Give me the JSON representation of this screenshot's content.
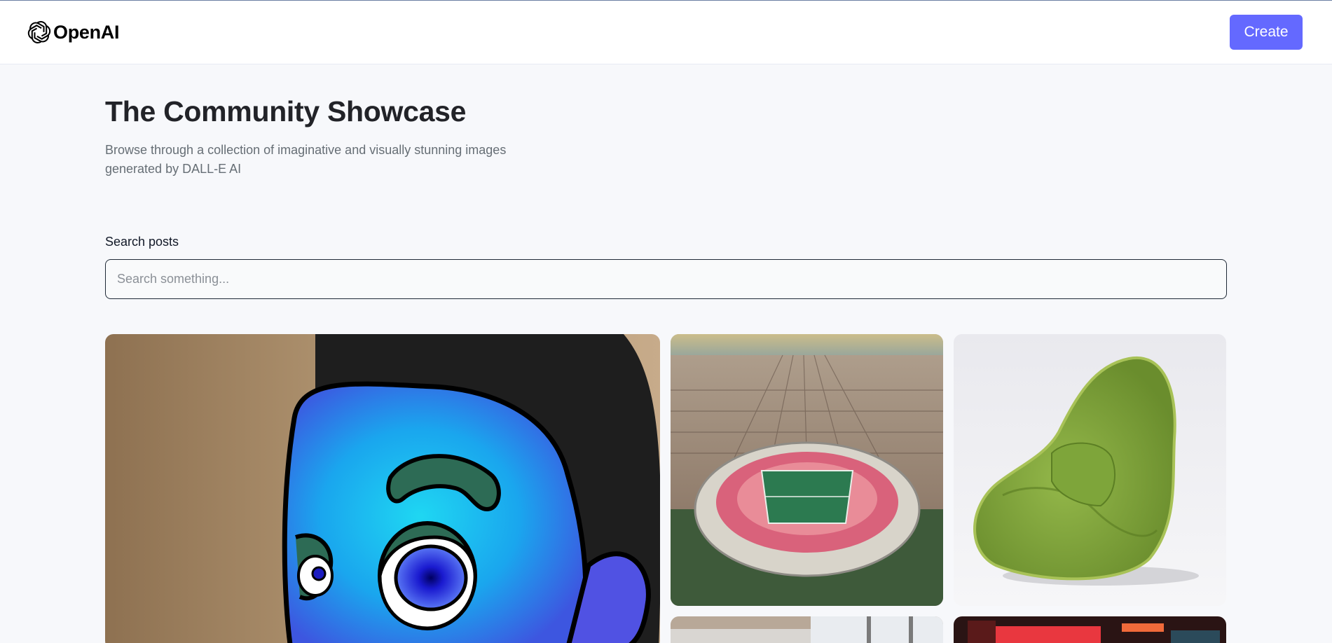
{
  "header": {
    "brand": "OpenAI",
    "logo_icon": "openai-logo-icon",
    "create_label": "Create",
    "accent_color": "#6469ff"
  },
  "page": {
    "title": "The Community Showcase",
    "subtitle": "Browse through a collection of imaginative and visually stunning images generated by DALL-E AI"
  },
  "search": {
    "label": "Search posts",
    "placeholder": "Search something...",
    "value": ""
  },
  "gallery": {
    "cards": [
      {
        "name": "blue-cartoon-face-image"
      },
      {
        "name": "aerial-stadium-image"
      },
      {
        "name": "green-avocado-chair-image"
      },
      {
        "name": "interior-window-image"
      },
      {
        "name": "neon-city-image"
      }
    ]
  }
}
